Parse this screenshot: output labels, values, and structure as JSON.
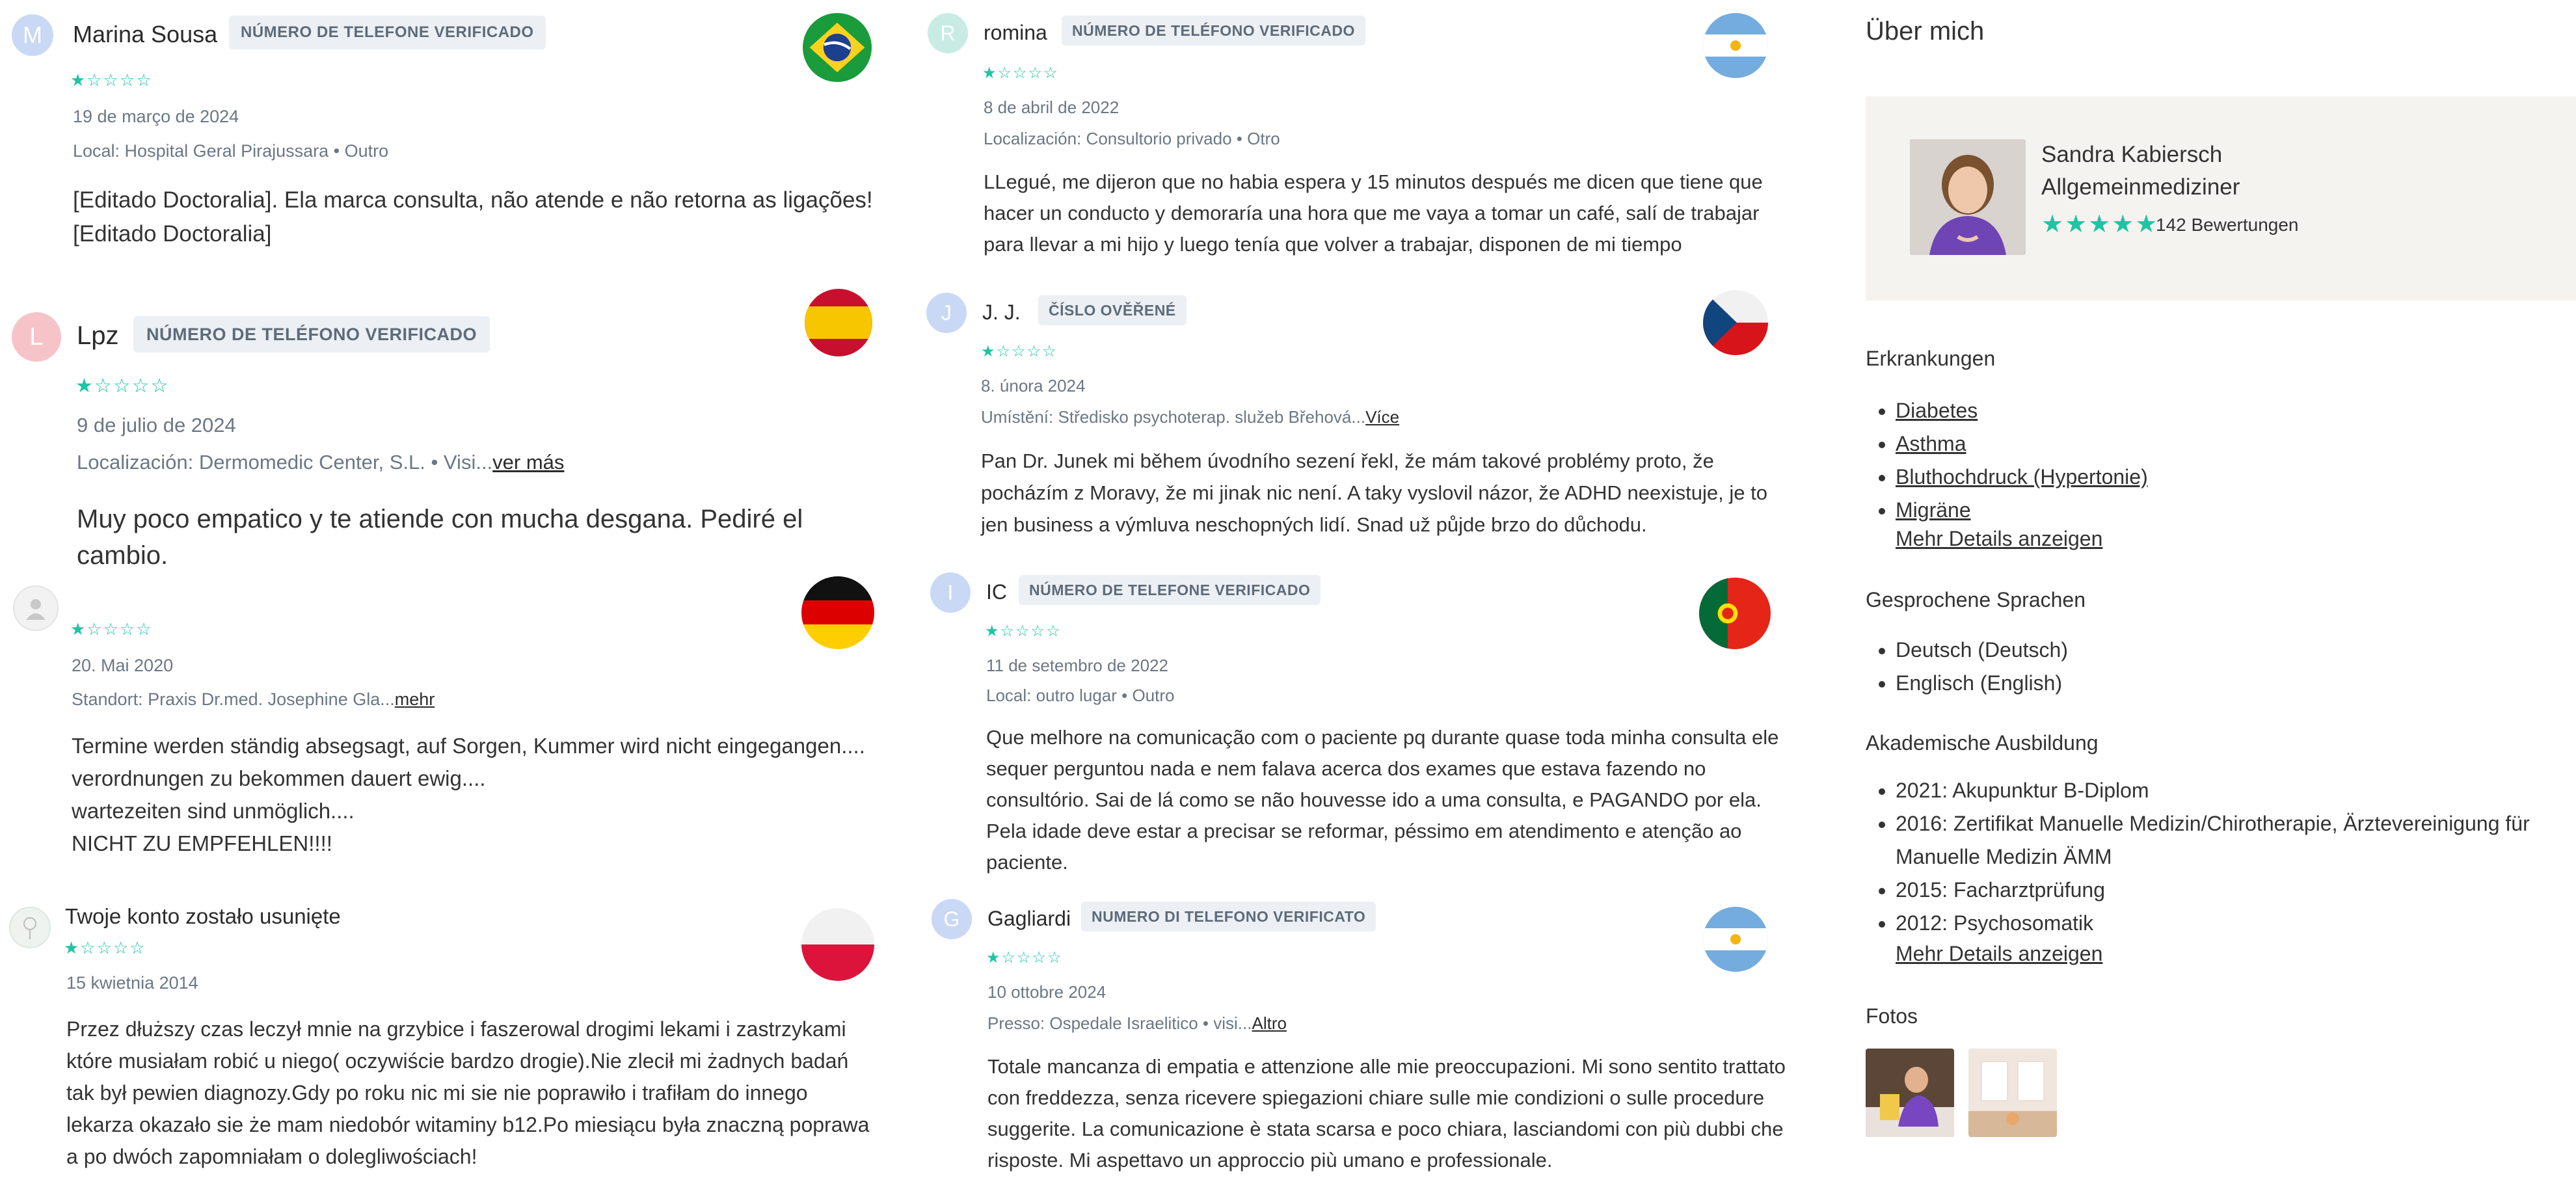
{
  "reviews": [
    {
      "id": "marina",
      "avatar_letter": "M",
      "avatar_color": "#c9d8f5",
      "name": "Marina Sousa",
      "badge": "NÚMERO DE TELEFONE VERIFICADO",
      "stars": "★☆☆☆☆",
      "date": "19 de março de 2024",
      "location": "Local: Hospital Geral Pirajussara • Outro",
      "more": "",
      "text": "[Editado Doctoralia]. Ela marca consulta, não atende e não retorna as ligações! [Editado Doctoralia]",
      "flag": "brazil-flag-icon"
    },
    {
      "id": "lpz",
      "avatar_letter": "L",
      "avatar_color": "#f6c4c8",
      "name": "Lpz",
      "badge": "NÚMERO DE TELÉFONO VERIFICADO",
      "stars": "★☆☆☆☆",
      "date": "9 de julio de 2024",
      "location": "Localización: Dermomedic Center, S.L. • Visi...",
      "more": "ver más",
      "text": "Muy poco empatico y te atiende con mucha desgana. Pediré el cambio.",
      "flag": "spain-flag-icon"
    },
    {
      "id": "anon",
      "avatar_letter": "",
      "avatar_color": "#eeeeee",
      "name": "",
      "badge": "",
      "stars": "★☆☆☆☆",
      "date": "20. Mai 2020",
      "location": "Standort: Praxis Dr.med. Josephine Gla...",
      "more": "mehr",
      "text": "Termine werden ständig absegsagt, auf Sorgen, Kummer wird nicht eingegangen.... verordnungen zu bekommen dauert ewig.... wartezeiten sind unmöglich.... NICHT ZU EMPFEHLEN!!!!",
      "flag": "germany-flag-icon"
    },
    {
      "id": "pl",
      "avatar_letter": "",
      "avatar_color": "#eef3ef",
      "name": "Twoje konto zostało usunięte",
      "badge": "",
      "stars": "★☆☆☆☆",
      "date": "15 kwietnia 2014",
      "location": "",
      "more": "",
      "text": "Przez dłuższy czas leczył mnie na grzybice i faszerowal drogimi lekami i zastrzykami które musiałam robić u niego( oczywiście bardzo drogie).Nie zlecił mi żadnych badań tak był pewien diagnozy.Gdy po roku nic mi sie nie poprawiło i trafiłam do innego lekarza okazało sie że mam niedobór witaminy b12.Po miesiącu była znaczną poprawa a po dwóch zapomniałam o dolegliwościach!",
      "flag": "poland-flag-icon"
    },
    {
      "id": "romina",
      "avatar_letter": "R",
      "avatar_color": "#c8ece3",
      "name": "romina",
      "badge": "NÚMERO DE TELÉFONO VERIFICADO",
      "stars": "★☆☆☆☆",
      "date": "8 de abril de 2022",
      "location": "Localización: Consultorio privado • Otro",
      "more": "",
      "text": "LLegué, me dijeron que no habia espera y 15 minutos después me dicen que tiene que hacer un conducto y demoraría una hora que me vaya a tomar un café, salí de trabajar para llevar a mi hijo y luego tenía que volver a trabajar, disponen de mi tiempo",
      "flag": "argentina-flag-icon"
    },
    {
      "id": "jj",
      "avatar_letter": "J",
      "avatar_color": "#c9d8f5",
      "name": "J. J.",
      "badge": "ČÍSLO OVĚŘENÉ",
      "stars": "★☆☆☆☆",
      "date": "8. února 2024",
      "location": "Umístění: Středisko psychoterap. služeb Břehová...",
      "more": "Více",
      "text": "Pan Dr. Junek mi během úvodního sezení řekl, že mám takové problémy proto, že pocházím z Moravy, že mi jinak nic není. A taky vyslovil názor, že ADHD neexistuje, je to jen business a výmluva neschopných lidí. Snad už půjde brzo do důchodu.",
      "flag": "czech-flag-icon"
    },
    {
      "id": "ic",
      "avatar_letter": "I",
      "avatar_color": "#c9d8f5",
      "name": "IC",
      "badge": "NÚMERO DE TELEFONE VERIFICADO",
      "stars": "★☆☆☆☆",
      "date": "11 de setembro de 2022",
      "location": "Local: outro lugar • Outro",
      "more": "",
      "text": "Que melhore na comunicação com o paciente pq durante quase toda minha consulta ele sequer perguntou nada e nem falava acerca dos exames que estava fazendo no consultório. Sai de lá como se não houvesse ido a uma consulta, e PAGANDO por ela. Pela idade deve estar a precisar se reformar, péssimo em atendimento e atenção ao paciente.",
      "flag": "portugal-flag-icon"
    },
    {
      "id": "gagliardi",
      "avatar_letter": "G",
      "avatar_color": "#c9d8f5",
      "name": "Gagliardi",
      "badge": "NUMERO DI TELEFONO VERIFICATO",
      "stars": "★☆☆☆☆",
      "date": "10 ottobre 2024",
      "location": "Presso: Ospedale Israelitico • visi...",
      "more": "Altro",
      "text": "Totale mancanza di empatia e attenzione alle mie preoccupazioni. Mi sono sentito trattato con freddezza, senza ricevere spiegazioni chiare sulle mie condizioni o sulle procedure suggerite. La comunicazione è stata scarsa e poco chiara, lasciandomi con più dubbi che risposte. Mi aspettavo un approccio più umano e professionale.",
      "flag": "argentina-flag-icon"
    }
  ],
  "about": {
    "title": "Über mich",
    "doctor_name": "Sandra Kabiersch",
    "specialty": "Allgemeinmediziner",
    "stars": "★★★★★",
    "reviews_count": "142 Bewertungen"
  },
  "conditions": {
    "title": "Erkrankungen",
    "items": [
      "Diabetes",
      "Asthma",
      "Bluthochdruck (Hypertonie)",
      "Migräne"
    ],
    "more": "Mehr Details anzeigen"
  },
  "languages": {
    "title": "Gesprochene Sprachen",
    "items": [
      "Deutsch (Deutsch)",
      "Englisch (English)"
    ]
  },
  "education": {
    "title": "Akademische Ausbildung",
    "items": [
      "2021: Akupunktur B-Diplom",
      "2016: Zertifikat Manuelle Medizin/Chirotherapie, Ärztevereinigung für Manuelle Medizin ÄMM",
      "2015: Facharztprüfung",
      "2012: Psychosomatik"
    ],
    "more": "Mehr Details anzeigen"
  },
  "photos": {
    "title": "Fotos"
  },
  "colors": {
    "star": "#1fc4a5",
    "badge_bg": "#eceff3",
    "about_bg": "#f5f3ef"
  }
}
